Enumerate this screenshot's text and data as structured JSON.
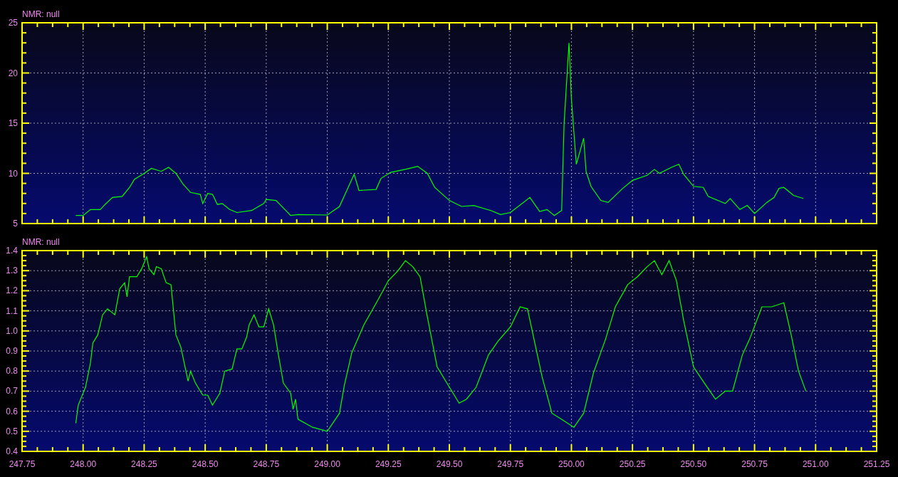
{
  "charts": [
    {
      "title": "NMR: null",
      "chart_data": {
        "type": "line",
        "grid": true,
        "xlim": [
          247.75,
          251.25
        ],
        "ylim": [
          5,
          25
        ],
        "yticks": [
          25,
          20,
          15,
          10,
          5
        ],
        "x": [
          247.97,
          248.0,
          248.03,
          248.07,
          248.09,
          248.12,
          248.16,
          248.19,
          248.21,
          248.25,
          248.28,
          248.32,
          248.35,
          248.38,
          248.41,
          248.44,
          248.48,
          248.49,
          248.51,
          248.53,
          248.55,
          248.57,
          248.6,
          248.63,
          248.69,
          248.74,
          248.75,
          248.79,
          248.83,
          248.85,
          248.88,
          249.0,
          249.05,
          249.08,
          249.11,
          249.13,
          249.2,
          249.22,
          249.26,
          249.32,
          249.37,
          249.41,
          249.44,
          249.5,
          249.55,
          249.6,
          249.67,
          249.71,
          249.75,
          249.83,
          249.87,
          249.9,
          249.93,
          249.96,
          249.97,
          249.99,
          250.0,
          250.02,
          250.05,
          250.06,
          250.08,
          250.12,
          250.15,
          250.21,
          250.25,
          250.31,
          250.34,
          250.36,
          250.41,
          250.44,
          250.46,
          250.5,
          250.54,
          250.56,
          250.63,
          250.65,
          250.69,
          250.72,
          250.75,
          250.8,
          250.83,
          250.85,
          250.87,
          250.91,
          250.95
        ],
        "series": [
          {
            "color": "#00ff00",
            "values": [
              5.8,
              5.8,
              6.4,
              6.4,
              6.9,
              7.6,
              7.7,
              8.6,
              9.4,
              10.0,
              10.5,
              10.2,
              10.6,
              10.0,
              8.9,
              8.1,
              7.9,
              7.0,
              8.0,
              7.9,
              6.9,
              7.0,
              6.4,
              6.1,
              6.3,
              7.0,
              7.4,
              7.3,
              6.3,
              5.8,
              5.9,
              5.85,
              6.7,
              8.3,
              9.9,
              8.3,
              8.4,
              9.5,
              10.1,
              10.4,
              10.7,
              10.0,
              8.6,
              7.3,
              6.7,
              6.8,
              6.3,
              5.9,
              6.1,
              7.6,
              6.2,
              6.4,
              5.8,
              6.3,
              14.9,
              23.0,
              17.4,
              10.9,
              13.5,
              10.2,
              8.7,
              7.3,
              7.1,
              8.5,
              9.3,
              9.8,
              10.4,
              10.0,
              10.6,
              10.9,
              9.9,
              8.7,
              8.6,
              7.7,
              7.0,
              7.5,
              6.4,
              6.8,
              6.0,
              7.1,
              7.6,
              8.5,
              8.6,
              7.8,
              7.5
            ]
          }
        ]
      }
    },
    {
      "title": "NMR: null",
      "chart_data": {
        "type": "line",
        "grid": true,
        "xlim": [
          247.75,
          251.25
        ],
        "ylim": [
          0.4,
          1.4
        ],
        "xticks": [
          {
            "value": 247.75,
            "label": "247.75"
          },
          {
            "value": 248,
            "label": "248.00"
          },
          {
            "value": 248.25,
            "label": "248.25"
          },
          {
            "value": 248.5,
            "label": "248.50"
          },
          {
            "value": 248.75,
            "label": "248.75"
          },
          {
            "value": 249,
            "label": "249.00"
          },
          {
            "value": 249.25,
            "label": "249.25"
          },
          {
            "value": 249.5,
            "label": "249.50"
          },
          {
            "value": 249.75,
            "label": "249.75"
          },
          {
            "value": 250,
            "label": "250.00"
          },
          {
            "value": 250.25,
            "label": "250.25"
          },
          {
            "value": 250.5,
            "label": "250.50"
          },
          {
            "value": 250.75,
            "label": "250.75"
          },
          {
            "value": 251,
            "label": "251.00"
          },
          {
            "value": 251.25,
            "label": "251.25"
          }
        ],
        "yticks": [
          {
            "value": 1.4,
            "label": "1.4"
          },
          {
            "value": 1.3,
            "label": "1.3"
          },
          {
            "value": 1.2,
            "label": "1.2"
          },
          {
            "value": 1.1,
            "label": "1.1"
          },
          {
            "value": 1.0,
            "label": "1.0"
          },
          {
            "value": 0.9,
            "label": "0.9"
          },
          {
            "value": 0.8,
            "label": "0.8"
          },
          {
            "value": 0.7,
            "label": "0.7"
          },
          {
            "value": 0.6,
            "label": "0.6"
          },
          {
            "value": 0.5,
            "label": "0.5"
          },
          {
            "value": 0.4,
            "label": "0.4"
          }
        ],
        "x": [
          247.97,
          247.98,
          248.01,
          248.03,
          248.04,
          248.06,
          248.08,
          248.1,
          248.13,
          248.15,
          248.17,
          248.18,
          248.19,
          248.22,
          248.24,
          248.26,
          248.27,
          248.29,
          248.3,
          248.32,
          248.34,
          248.36,
          248.38,
          248.4,
          248.43,
          248.44,
          248.46,
          248.49,
          248.51,
          248.53,
          248.56,
          248.58,
          248.61,
          248.63,
          248.65,
          248.67,
          248.68,
          248.7,
          248.72,
          248.74,
          248.76,
          248.78,
          248.8,
          248.82,
          248.85,
          248.86,
          248.87,
          248.88,
          248.94,
          249.0,
          249.05,
          249.07,
          249.1,
          249.15,
          249.21,
          249.25,
          249.29,
          249.32,
          249.35,
          249.38,
          249.41,
          249.45,
          249.5,
          249.54,
          249.57,
          249.61,
          249.66,
          249.7,
          249.75,
          249.79,
          249.82,
          249.88,
          249.92,
          249.96,
          250.01,
          250.05,
          250.09,
          250.14,
          250.18,
          250.23,
          250.27,
          250.31,
          250.34,
          250.37,
          250.4,
          250.43,
          250.46,
          250.5,
          250.55,
          250.59,
          250.63,
          250.66,
          250.7,
          250.73,
          250.78,
          250.82,
          250.87,
          250.9,
          250.93,
          250.96
        ],
        "series": [
          {
            "color": "#00ff00",
            "values": [
              0.54,
              0.63,
              0.72,
              0.84,
              0.94,
              0.98,
              1.08,
              1.11,
              1.08,
              1.21,
              1.24,
              1.17,
              1.27,
              1.27,
              1.31,
              1.37,
              1.31,
              1.28,
              1.32,
              1.31,
              1.24,
              1.23,
              0.98,
              0.92,
              0.75,
              0.8,
              0.74,
              0.68,
              0.68,
              0.63,
              0.69,
              0.8,
              0.81,
              0.91,
              0.91,
              0.97,
              1.03,
              1.08,
              1.02,
              1.02,
              1.11,
              1.03,
              0.88,
              0.74,
              0.69,
              0.61,
              0.66,
              0.56,
              0.52,
              0.5,
              0.59,
              0.73,
              0.89,
              1.03,
              1.16,
              1.25,
              1.3,
              1.35,
              1.32,
              1.27,
              1.07,
              0.82,
              0.72,
              0.64,
              0.66,
              0.72,
              0.88,
              0.95,
              1.02,
              1.12,
              1.11,
              0.77,
              0.59,
              0.56,
              0.52,
              0.59,
              0.79,
              0.96,
              1.12,
              1.23,
              1.27,
              1.32,
              1.35,
              1.28,
              1.35,
              1.25,
              1.05,
              0.82,
              0.73,
              0.66,
              0.7,
              0.7,
              0.88,
              0.96,
              1.12,
              1.12,
              1.14,
              0.98,
              0.8,
              0.7
            ]
          }
        ]
      }
    }
  ]
}
